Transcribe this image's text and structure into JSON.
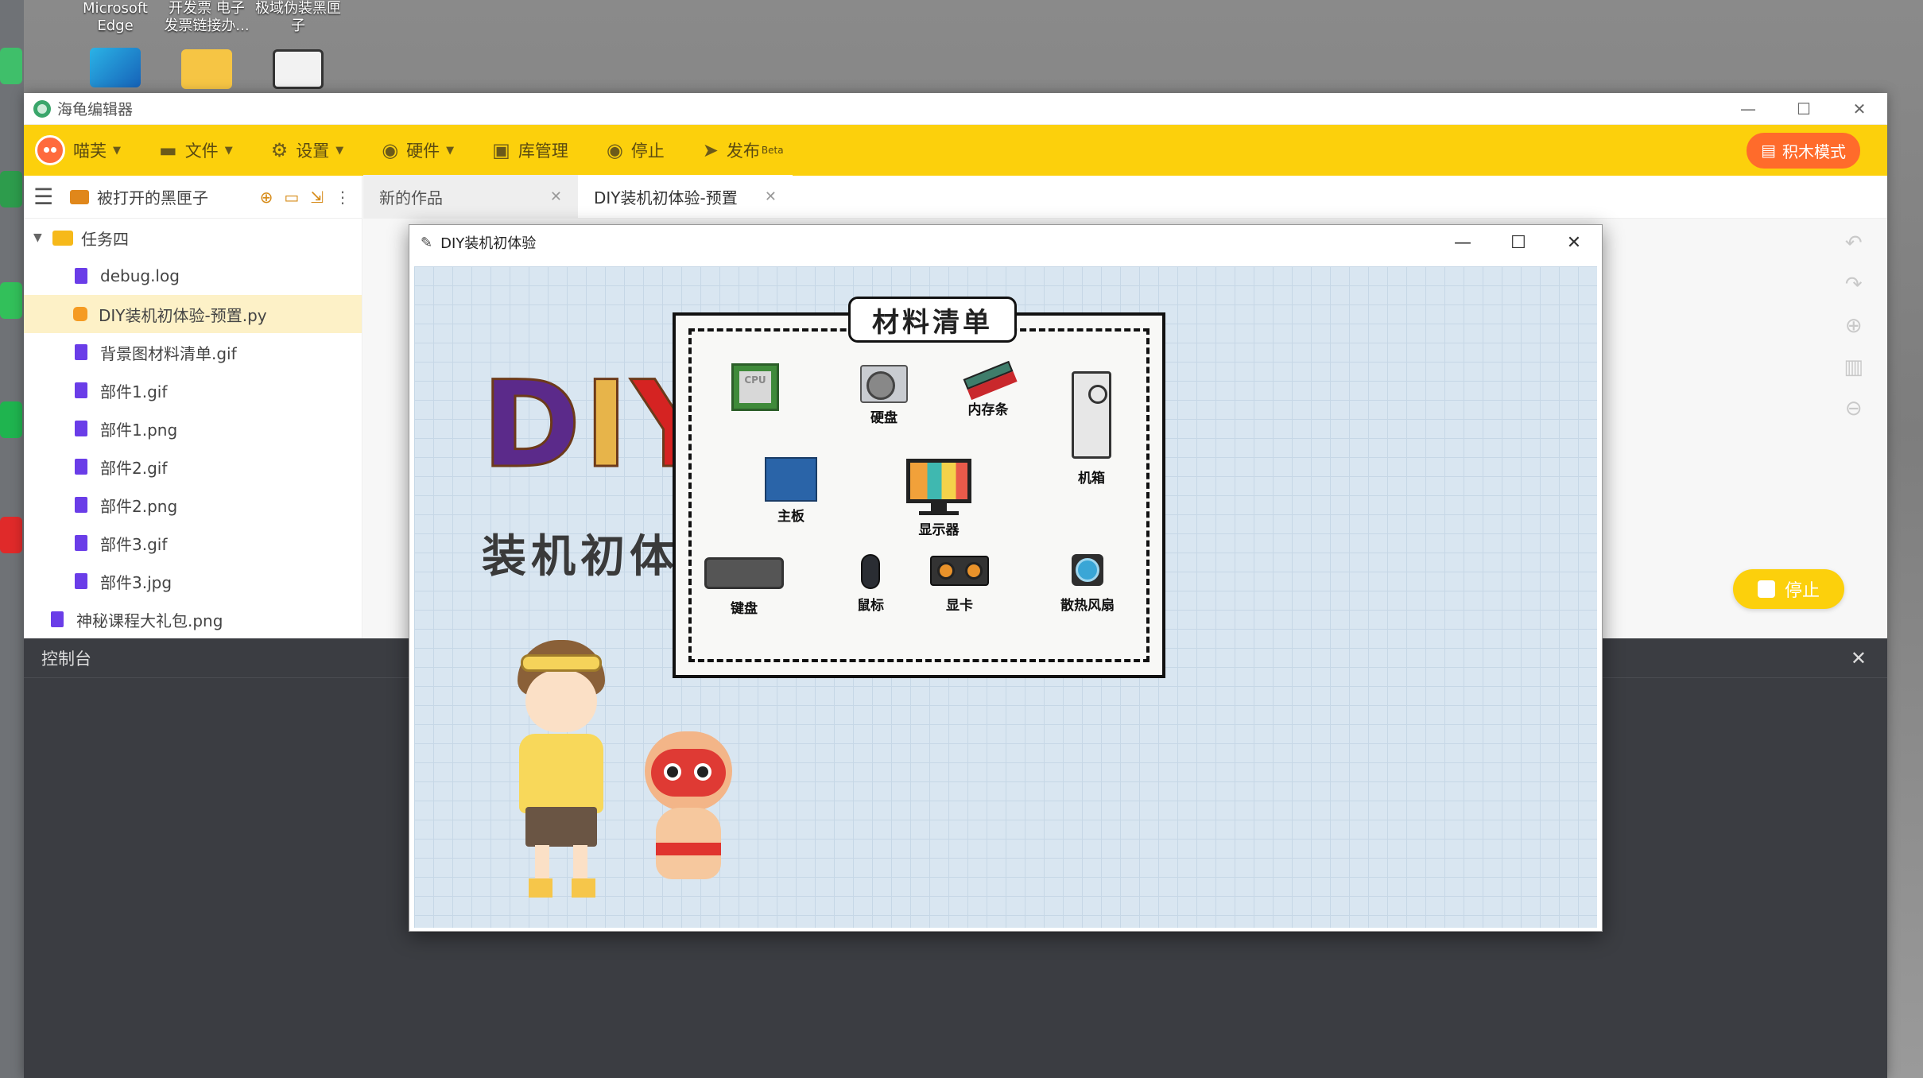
{
  "desktop": {
    "icons": [
      {
        "label": "Microsoft Edge",
        "icon": "edge-icon"
      },
      {
        "label": "开发票 电子发票链接办...",
        "icon": "folder-icon"
      },
      {
        "label": "极域伪装黑匣子",
        "icon": "screen-recorder-icon"
      }
    ],
    "top_labels": [
      "Microsoft",
      "Edge",
      "开发票 电子",
      "发票链接办...",
      "极域伪装黑匣",
      "子"
    ]
  },
  "app": {
    "title": "海龟编辑器",
    "window_controls": [
      "—",
      "☐",
      "✕"
    ]
  },
  "menubar": {
    "user": "喵芙",
    "items": [
      {
        "label": "文件",
        "icon": "folder-icon",
        "dropdown": true
      },
      {
        "label": "设置",
        "icon": "gear-icon",
        "dropdown": true
      },
      {
        "label": "硬件",
        "icon": "hardware-icon",
        "dropdown": true
      },
      {
        "label": "库管理",
        "icon": "library-icon",
        "dropdown": false
      },
      {
        "label": "停止",
        "icon": "stop-icon",
        "dropdown": false
      },
      {
        "label": "发布",
        "icon": "send-icon",
        "badge": "Beta"
      }
    ],
    "block_mode": "积木模式"
  },
  "file_panel": {
    "title": "被打开的黑匣子",
    "folder": "任务四",
    "files": [
      {
        "name": "debug.log",
        "type": "file"
      },
      {
        "name": "DIY装机初体验-预置.py",
        "type": "py",
        "selected": true
      },
      {
        "name": "背景图材料清单.gif",
        "type": "file"
      },
      {
        "name": "部件1.gif",
        "type": "file"
      },
      {
        "name": "部件1.png",
        "type": "file"
      },
      {
        "name": "部件2.gif",
        "type": "file"
      },
      {
        "name": "部件2.png",
        "type": "file"
      },
      {
        "name": "部件3.gif",
        "type": "file"
      },
      {
        "name": "部件3.jpg",
        "type": "file"
      }
    ],
    "root_file": "神秘课程大礼包.png"
  },
  "tabs": [
    {
      "label": "新的作品",
      "active": false
    },
    {
      "label": "DIY装机初体验-预置",
      "active": true
    }
  ],
  "run_button": {
    "label": "停止"
  },
  "console": {
    "title": "控制台",
    "close": "✕"
  },
  "game_window": {
    "title": "DIY装机初体验",
    "controls": [
      "—",
      "☐",
      "✕"
    ],
    "logo": {
      "d": "D",
      "i": "I",
      "y": "Y"
    },
    "subtitle": "装机初体验",
    "materials_title": "材料清单",
    "cpu_text": "CPU",
    "parts": [
      {
        "label": "硬盘",
        "icon": "hard-disk-icon"
      },
      {
        "label": "内存条",
        "icon": "ram-icon"
      },
      {
        "label": "主板",
        "icon": "motherboard-icon"
      },
      {
        "label": "显示器",
        "icon": "monitor-icon"
      },
      {
        "label": "机箱",
        "icon": "pc-case-icon"
      },
      {
        "label": "键盘",
        "icon": "keyboard-icon"
      },
      {
        "label": "鼠标",
        "icon": "mouse-icon"
      },
      {
        "label": "显卡",
        "icon": "gpu-icon"
      },
      {
        "label": "散热风扇",
        "icon": "cooling-fan-icon"
      }
    ]
  },
  "colors": {
    "accent": "#fcd00c",
    "block_mode": "#ff6b2b",
    "selected_row": "#fdf1c7",
    "console_bg": "#3b3d42",
    "file_icon": "#6a3de8"
  }
}
